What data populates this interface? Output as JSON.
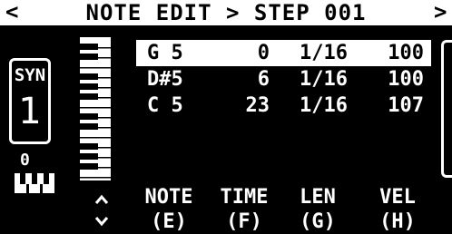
{
  "header": {
    "title": "NOTE EDIT > STEP 001",
    "prev_icon": "chevron-left-icon",
    "next_icon": "chevron-right-icon"
  },
  "track": {
    "name": "SYN",
    "number": "1",
    "octave": "0",
    "octave_icon": "mini-keyboard-icon"
  },
  "notes": [
    {
      "note": "G 5",
      "time": "0",
      "length": "1/16",
      "velocity": "100",
      "selected": true
    },
    {
      "note": "D#5",
      "time": "6",
      "length": "1/16",
      "velocity": "100",
      "selected": false
    },
    {
      "note": "C 5",
      "time": "23",
      "length": "1/16",
      "velocity": "107",
      "selected": false
    }
  ],
  "softkeys": {
    "note": {
      "label": "NOTE",
      "key": "(E)"
    },
    "time": {
      "label": "TIME",
      "key": "(F)"
    },
    "length": {
      "label": "LEN",
      "key": "(G)"
    },
    "velocity": {
      "label": "VEL",
      "key": "(H)"
    }
  },
  "colors": {
    "background": "#000000",
    "foreground": "#ffffff"
  }
}
